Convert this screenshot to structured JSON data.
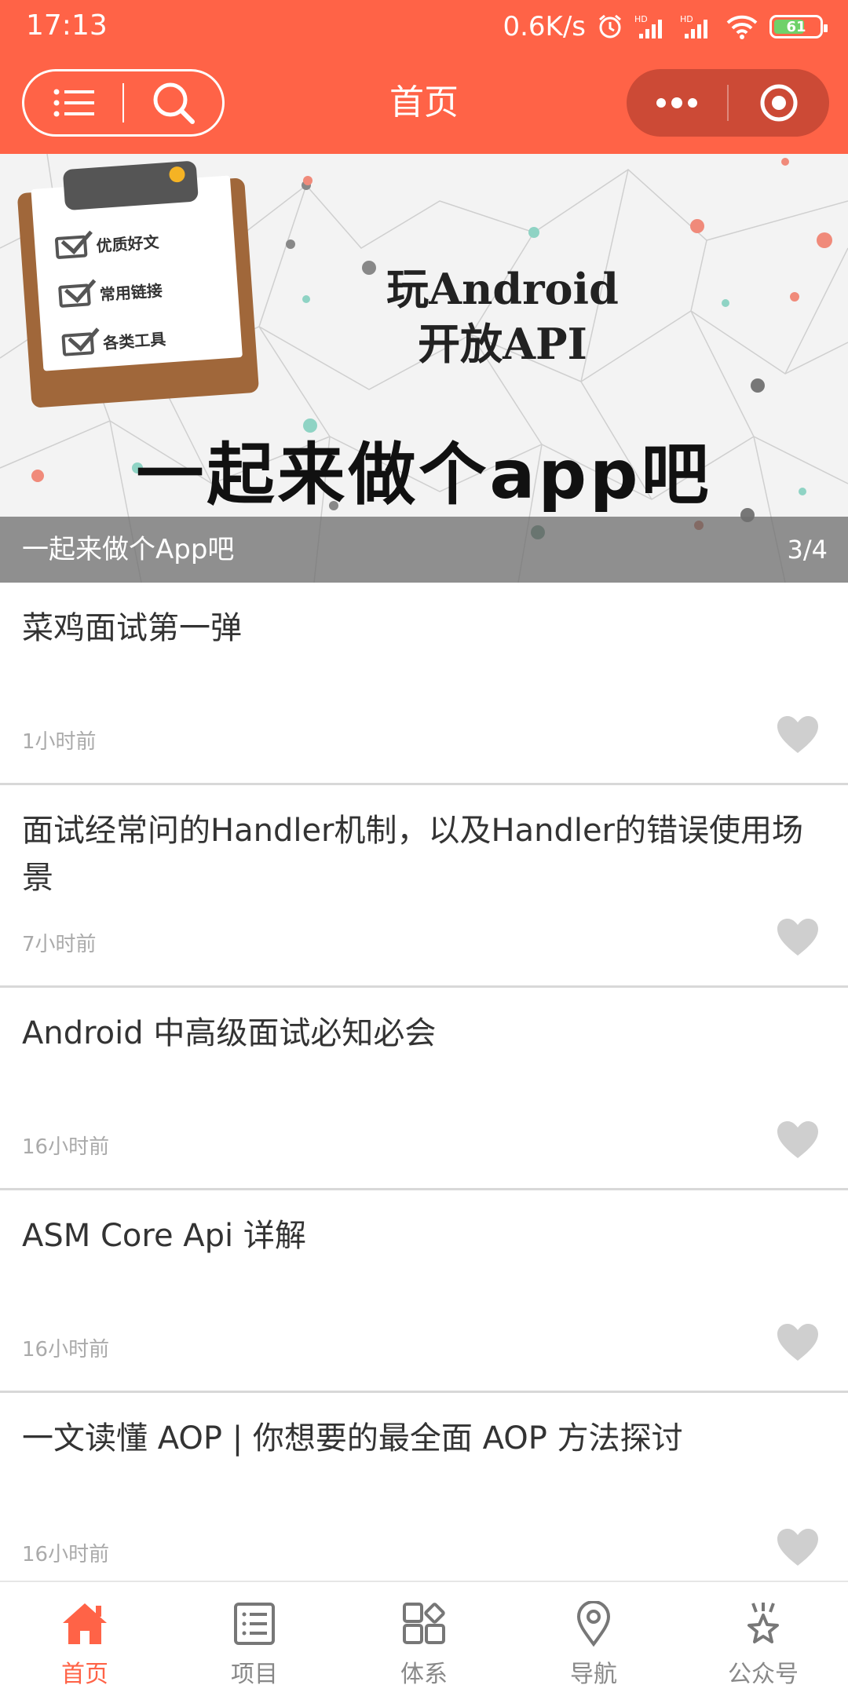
{
  "status_bar": {
    "time": "17:13",
    "network_speed": "0.6K/s",
    "battery_level": "61",
    "icons": [
      "alarm-icon",
      "signal-hd-icon",
      "signal-hd-icon",
      "wifi-icon",
      "battery-icon"
    ]
  },
  "header": {
    "title": "首页",
    "accent_color": "#ff6347"
  },
  "banner": {
    "headline_line1": "玩Android",
    "headline_line2": "开放API",
    "slogan": "一起来做个app吧",
    "checklist": [
      "优质好文",
      "常用链接",
      "各类工具"
    ],
    "caption": "一起来做个App吧",
    "counter": "3/4"
  },
  "articles": [
    {
      "title": "菜鸡面试第一弹",
      "time": "1小时前"
    },
    {
      "title": "面试经常问的Handler机制，以及Handler的错误使用场景",
      "time": "7小时前"
    },
    {
      "title": "Android 中高级面试必知必会",
      "time": "16小时前"
    },
    {
      "title": "ASM Core Api 详解",
      "time": "16小时前"
    },
    {
      "title": "一文读懂 AOP | 你想要的最全面 AOP 方法探讨",
      "time": "16小时前"
    }
  ],
  "tabs": [
    {
      "label": "首页",
      "icon": "home-icon",
      "active": true
    },
    {
      "label": "项目",
      "icon": "list-icon",
      "active": false
    },
    {
      "label": "体系",
      "icon": "grid-icon",
      "active": false
    },
    {
      "label": "导航",
      "icon": "location-pin-icon",
      "active": false
    },
    {
      "label": "公众号",
      "icon": "star-badge-icon",
      "active": false
    }
  ]
}
